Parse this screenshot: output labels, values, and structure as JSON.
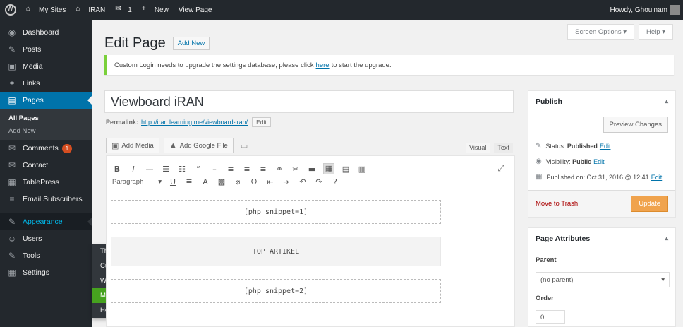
{
  "adminbar": {
    "site_name": "My Sites",
    "site": "IRAN",
    "comments_count": "1",
    "new_label": "New",
    "view_page": "View Page",
    "howdy": "Howdy, Ghoulnam"
  },
  "sidebar": {
    "items": [
      {
        "label": "Dashboard",
        "icon": "dashboard-icon",
        "glyph": "◉"
      },
      {
        "label": "Posts",
        "icon": "pin-icon",
        "glyph": "✎"
      },
      {
        "label": "Media",
        "icon": "media-icon",
        "glyph": "▣"
      },
      {
        "label": "Links",
        "icon": "link-icon",
        "glyph": "⚭"
      },
      {
        "label": "Pages",
        "icon": "pages-icon",
        "glyph": "▤"
      },
      {
        "label": "Comments",
        "icon": "comment-icon",
        "glyph": "✉"
      },
      {
        "label": "Contact",
        "icon": "mail-icon",
        "glyph": "✉"
      },
      {
        "label": "TablePress",
        "icon": "table-icon",
        "glyph": "▦"
      },
      {
        "label": "Email Subscribers",
        "icon": "list-icon",
        "glyph": "≡"
      },
      {
        "label": "Appearance",
        "icon": "brush-icon",
        "glyph": "✎"
      },
      {
        "label": "Users",
        "icon": "users-icon",
        "glyph": "☺"
      },
      {
        "label": "Tools",
        "icon": "wrench-icon",
        "glyph": "✎"
      },
      {
        "label": "Settings",
        "icon": "settings-icon",
        "glyph": "▦"
      }
    ],
    "pages_submenu": [
      "All Pages",
      "Add New"
    ],
    "comments_badge": "1"
  },
  "flyout": {
    "items": [
      "Themes",
      "Customize",
      "Widgets",
      "Menus",
      "Header"
    ]
  },
  "screen_meta": {
    "screen_options": "Screen Options ▾",
    "help": "Help ▾"
  },
  "heading": {
    "title": "Edit Page",
    "add_new": "Add New"
  },
  "notice": {
    "before": "Custom Login needs to upgrade the settings database, please click",
    "link": "here",
    "after": "to start the upgrade."
  },
  "editor": {
    "post_title": "Viewboard iRAN",
    "permalink_label": "Permalink:",
    "permalink_url": "http://iran.learning.me/viewboard-iran/",
    "permalink_edit": "Edit",
    "add_media": "Add Media",
    "add_google_file": "Add Google File",
    "tab_visual": "Visual",
    "tab_text": "Text",
    "paragraph": "Paragraph",
    "blocks": [
      "[php snippet=1]",
      "TOP ARTIKEL",
      "[php snippet=2]"
    ]
  },
  "publish": {
    "title": "Publish",
    "preview": "Preview Changes",
    "status_label": "Status:",
    "status_value": "Published",
    "status_edit": "Edit",
    "visibility_label": "Visibility:",
    "visibility_value": "Public",
    "visibility_edit": "Edit",
    "published_on": "Published on: Oct 31, 2016 @ 12:41",
    "published_edit": "Edit",
    "trash": "Move to Trash",
    "update": "Update"
  },
  "attributes": {
    "title": "Page Attributes",
    "parent_label": "Parent",
    "parent_value": "(no parent)",
    "order_label": "Order",
    "order_value": "0"
  },
  "colors": {
    "adminbar_bg": "#23282d",
    "current_menu": "#0073aa",
    "flyout_active": "#46a21f",
    "update_button": "#f0a34d",
    "notice_border": "#7ad03a"
  }
}
